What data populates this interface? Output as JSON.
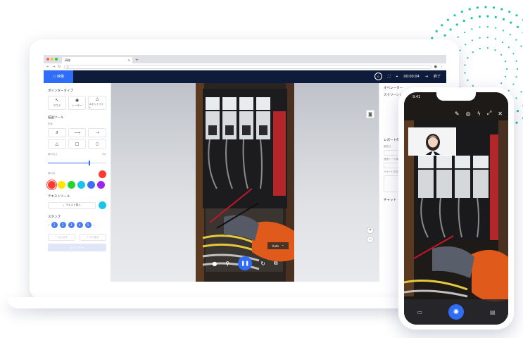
{
  "colors": {
    "accent": "#2f6df6",
    "appbar": "#0f1b3a",
    "teal": "#1bc6a8",
    "palette": [
      "#ff3b30",
      "#ffe600",
      "#27d32e",
      "#16c5e8",
      "#3f6ff5",
      "#a020f0"
    ],
    "selected_color": "#ff3b30",
    "text_color": "#16c5e8"
  },
  "browser": {
    "tab_title": "研修",
    "tab_close": "×",
    "new_tab": "+",
    "address": "G"
  },
  "app": {
    "tab_label": "映像",
    "timer": "00:00:04",
    "end_label": "終了"
  },
  "left_panel": {
    "pointer_type_title": "ポインタータイプ",
    "pointer_types": [
      "マウス",
      "レーザー",
      "スポットライト"
    ],
    "drawing_tools_title": "描画ツール",
    "drawing_tools_sub": "形状",
    "line_width_label": "線の太さ",
    "line_width_value": "7px",
    "line_width_fraction": 0.7,
    "line_color_label": "線の色",
    "text_tool_title": "テキストツール",
    "text_insert": "テキスト挿入",
    "stamp_title": "スタンプ",
    "stamps": [
      "1",
      "2",
      "3",
      "4",
      "5"
    ],
    "undo": "元に戻す",
    "redo": "やり直す",
    "capture": "キャプチャ"
  },
  "video": {
    "auto_label": "Auto"
  },
  "right_panel": {
    "operator": "オペレーター",
    "screenshot": "スクリーンシ",
    "report_title": "レポート作成",
    "fields": [
      "報告日",
      "連絡ツール情報",
      "サポート内容"
    ],
    "chat": "チャット"
  },
  "phone": {
    "time": "9:41"
  }
}
